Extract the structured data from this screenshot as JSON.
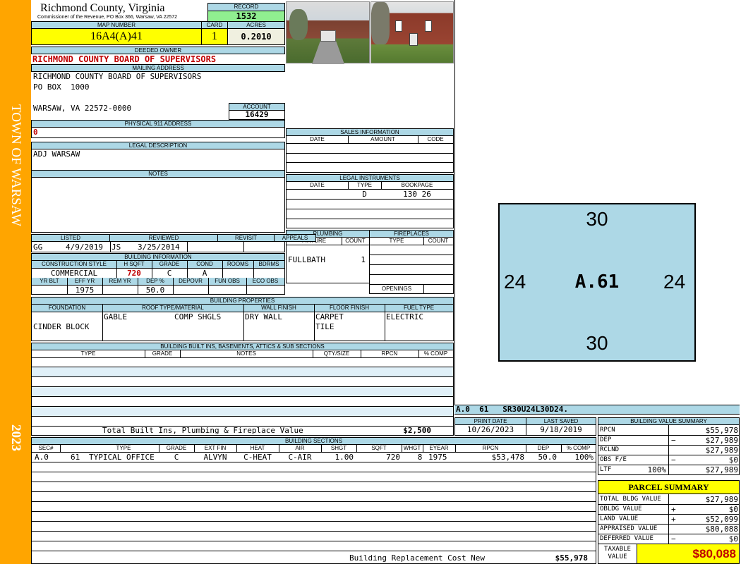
{
  "sidebar": {
    "town": "TOWN OF WARSAW",
    "year": "2023"
  },
  "header": {
    "county": "Richmond County, Virginia",
    "commissioner": "Commissioner of the Revenue, PO Box 366, Warsaw, VA 22572"
  },
  "record": {
    "label": "RECORD",
    "value": "1532"
  },
  "map": {
    "label": "MAP NUMBER",
    "value": "16A4(A)41",
    "card_label": "CARD",
    "card": "1",
    "acres_label": "ACRES",
    "acres": "0.2010"
  },
  "owner": {
    "label": "DEEDED OWNER",
    "value": "RICHMOND COUNTY BOARD OF SUPERVISORS"
  },
  "mailing": {
    "label": "MAILING ADDRESS",
    "line1": "RICHMOND COUNTY BOARD OF SUPERVISORS",
    "line2": "PO BOX  1000",
    "line3": "WARSAW, VA 22572-0000"
  },
  "account": {
    "label": "ACCOUNT",
    "value": "16429"
  },
  "physical": {
    "label": "PHYSICAL 911 ADDRESS",
    "value": "0"
  },
  "legal": {
    "label": "LEGAL DESCRIPTION",
    "value": "ADJ WARSAW"
  },
  "notes": {
    "label": "NOTES"
  },
  "sales": {
    "label": "SALES INFORMATION",
    "cols": [
      "DATE",
      "AMOUNT",
      "CODE"
    ]
  },
  "instruments": {
    "label": "LEGAL INSTRUMENTS",
    "cols": [
      "DATE",
      "TYPE",
      "BOOKPAGE"
    ],
    "type": "D",
    "bookpage": "130 26"
  },
  "plumbing": {
    "label": "PLUMBING",
    "cols": [
      "FIXTURE",
      "COUNT"
    ],
    "fixture": "FULLBATH",
    "count": "1"
  },
  "fireplaces": {
    "label": "FIREPLACES",
    "cols": [
      "TYPE",
      "COUNT"
    ],
    "openings": "OPENINGS"
  },
  "listing": {
    "cols": [
      "LISTED",
      "REVIEWED",
      "REVISIT",
      "APPEALS"
    ],
    "listed_by": "GG",
    "listed_date": "4/9/2019",
    "reviewed_by": "JS",
    "reviewed_date": "3/25/2014"
  },
  "building_info": {
    "label": "BUILDING INFORMATION",
    "cols": [
      "CONSTRUCTION STYLE",
      "H SQFT",
      "GRADE",
      "COND",
      "ROOMS",
      "BDRMS"
    ],
    "style": "COMMERCIAL",
    "hsqft": "720",
    "grade": "C",
    "cond": "A",
    "cols2": [
      "YR BLT",
      "EFF YR",
      "REM YR",
      "DEP %",
      "DEPOVR",
      "FUN OBS",
      "ECO OBS"
    ],
    "eff_yr": "1975",
    "dep": "50.0"
  },
  "properties": {
    "label": "BUILDING PROPERTIES",
    "cols": [
      "FOUNDATION",
      "ROOF TYPE/MATERIAL",
      "WALL FINISH",
      "FLOOR FINISH",
      "FUEL TYPE"
    ],
    "foundation": "CINDER BLOCK",
    "roof_type": "GABLE",
    "roof_material": "COMP SHGLS",
    "wall": "DRY WALL",
    "floor1": "CARPET",
    "floor2": "TILE",
    "fuel": "ELECTRIC"
  },
  "builtins": {
    "label": "BUILDING BUILT INS, BASEMENTS, ATTICS & SUB SECTIONS",
    "cols": [
      "TYPE",
      "GRADE",
      "NOTES",
      "QTY/SIZE",
      "RPCN",
      "% COMP"
    ],
    "total_label": "Total Built Ins, Plumbing & Fireplace Value",
    "total": "$2,500"
  },
  "sketch": {
    "top": "30",
    "bottom": "30",
    "left": "24",
    "right": "24",
    "label": "A.61",
    "code": "A.0  61   SR30U24L30D24."
  },
  "dates": {
    "print_label": "PRINT DATE",
    "print": "10/26/2023",
    "saved_label": "LAST SAVED",
    "saved": "9/18/2019"
  },
  "sections": {
    "label": "BUILDING SECTIONS",
    "cols": [
      "SEC#",
      "TYPE",
      "GRADE",
      "EXT FIN",
      "HEAT",
      "AIR",
      "SHGT",
      "SQFT",
      "WHGT",
      "EYEAR",
      "RPCN",
      "DEP",
      "% COMP"
    ],
    "row": {
      "sec": "A.0",
      "num": "61",
      "type": "TYPICAL OFFICE",
      "grade": "C",
      "ext": "ALVYN",
      "heat": "C-HEAT",
      "air": "C-AIR",
      "shgt": "1.00",
      "sqft": "720",
      "whgt": "8",
      "eyear": "1975",
      "rpcn": "$53,478",
      "dep": "50.0",
      "comp": "100%"
    },
    "total_label": "Building Replacement Cost New",
    "total": "$55,978"
  },
  "value_summary": {
    "label": "BUILDING VALUE SUMMARY",
    "rpcn_label": "RPCN",
    "rpcn": "$55,978",
    "dep_label": "DEP",
    "dep_sign": "−",
    "dep": "$27,989",
    "rclnd_label": "RCLND",
    "rclnd": "$27,989",
    "obs_label": "OBS F/E",
    "obs_sign": "−",
    "obs": "$0",
    "ltf_label": "LTF",
    "ltf_pct": "100%",
    "ltf": "$27,989"
  },
  "parcel": {
    "title": "PARCEL SUMMARY",
    "bldg_label": "TOTAL BLDG VALUE",
    "bldg": "$27,989",
    "obldg_label": "OBLDG VALUE",
    "obldg_sign": "+",
    "obldg": "$0",
    "land_label": "LAND VALUE",
    "land_sign": "+",
    "land": "$52,099",
    "appraised_label": "APPRAISED VALUE",
    "appraised": "$80,088",
    "deferred_label": "DEFERRED VALUE",
    "deferred_sign": "−",
    "deferred": "$0",
    "taxable_label1": "TAXABLE",
    "taxable_label2": "VALUE",
    "taxable": "$80,088"
  },
  "colors": {
    "sidebar": "#ffa500",
    "header_blue": "#add8e6",
    "yellow": "#ffff00",
    "green": "#90ee90",
    "sketch": "#add8e6",
    "accent_red": "#c00000"
  }
}
